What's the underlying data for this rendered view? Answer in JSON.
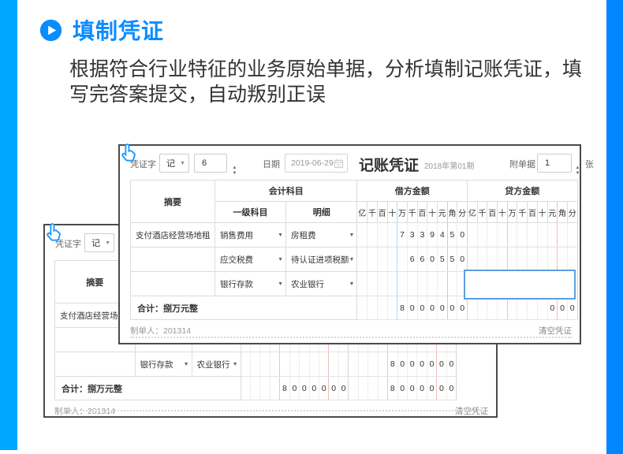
{
  "section": {
    "title": "填制凭证",
    "description": "根据符合行业特征的业务原始单据，分析填制记账凭证，填写完答案提交，自动叛别正误"
  },
  "colors": {
    "accent": "#0a8cff",
    "left_bar": "#00a7ff",
    "right_bar": "#0087ff",
    "active_input_border": "#5b9fe0"
  },
  "table": {
    "summary": "摘要",
    "account_title": "会计科目",
    "subject": "一级科目",
    "detail": "明细",
    "debit": "借方金额",
    "credit": "贷方金额",
    "digit_columns": [
      "亿",
      "千",
      "百",
      "十",
      "万",
      "千",
      "百",
      "十",
      "元",
      "角",
      "分"
    ]
  },
  "vouchers": [
    {
      "id": "voucher-back",
      "header": {
        "voucher_word_label": "凭证字",
        "voucher_type": "记",
        "voucher_number": "6"
      },
      "rows": [
        {
          "summary": "支付酒店经营场地租",
          "subject": "",
          "detail": "",
          "debit": "",
          "credit": ""
        },
        {
          "summary": "",
          "subject": "",
          "detail": "",
          "debit": "",
          "credit": ""
        },
        {
          "summary": "",
          "subject": "银行存款",
          "detail": "农业银行",
          "debit": "",
          "credit": "8000000"
        }
      ],
      "total": {
        "label": "合计：捌万元整",
        "debit": "8000000",
        "credit": "8000000"
      },
      "footer": {
        "maker": "制单人：201314",
        "clear_action": "清空凭证"
      }
    },
    {
      "id": "voucher-front",
      "header": {
        "voucher_word_label": "凭证字",
        "voucher_type": "记",
        "voucher_number": "6",
        "date_label": "日期",
        "date_value": "2019-06-29",
        "title": "记账凭证",
        "period": "2018年第01期",
        "attach_label": "附单据",
        "attach_count": "1",
        "attach_unit": "张"
      },
      "rows": [
        {
          "summary": "支付酒店经营场地租",
          "subject": "销售费用",
          "detail": "房租费",
          "debit": "7339450",
          "credit": ""
        },
        {
          "summary": "",
          "subject": "应交税费",
          "detail": "待认证进项税额",
          "debit": "660550",
          "credit": ""
        },
        {
          "summary": "",
          "subject": "银行存款",
          "detail": "农业银行",
          "debit": "",
          "credit": "",
          "credit_active_input": true
        }
      ],
      "total": {
        "label": "合计：捌万元整",
        "debit": "8000000",
        "credit": "000"
      },
      "footer": {
        "maker": "制单人：201314",
        "clear_action": "清空凭证"
      }
    }
  ]
}
